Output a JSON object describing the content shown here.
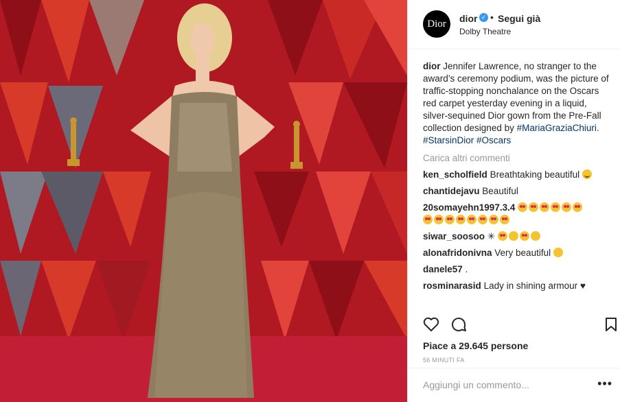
{
  "post": {
    "author": "dior",
    "follow_state": "Segui già",
    "separator": "•",
    "location": "Dolby Theatre",
    "avatar_text": "Dior",
    "verified_mark": "✓",
    "caption_user": "dior",
    "caption_text": "Jennifer Lawrence, no stranger to the award’s ceremony podium, was the picture of traffic-stopping nonchalance on the Oscars red carpet yesterday evening in a liquid, silver-sequined Dior gown from the Pre-Fall collection designed by",
    "caption_tag1": "#MariaGraziaChiuri",
    "caption_period": ".",
    "caption_tag2": "#StarsinDior",
    "caption_tag3": "#Oscars",
    "load_more": "Carica altri commenti",
    "likes": "Piace a 29.645 persone",
    "timestamp": "56 MINUTI FA",
    "add_comment_placeholder": "Aggiungi un commento...",
    "more_options": "•••"
  },
  "comments": [
    {
      "user": "ken_scholfield",
      "text": "Breathtaking beautiful"
    },
    {
      "user": "chantidejavu",
      "text": "Beautiful"
    },
    {
      "user": "20somayehn1997.3.4",
      "text": ""
    },
    {
      "user": "siwar_soosoo",
      "text": "✳"
    },
    {
      "user": "alonafridonivna",
      "text": "Very beautiful"
    },
    {
      "user": "danele57",
      "text": "."
    },
    {
      "user": "rosminarasid",
      "text": "Lady in shining armour"
    }
  ],
  "icons": [
    "heart-icon",
    "comment-icon",
    "bookmark-icon",
    "verified-badge-icon",
    "thumbs-up-emoji",
    "black-heart-emoji",
    "heart-eyes-emoji",
    "smile-emoji"
  ],
  "colors": {
    "link": "#003569",
    "verified": "#3897f0",
    "muted": "#999999",
    "carpet": "#c21f36"
  }
}
